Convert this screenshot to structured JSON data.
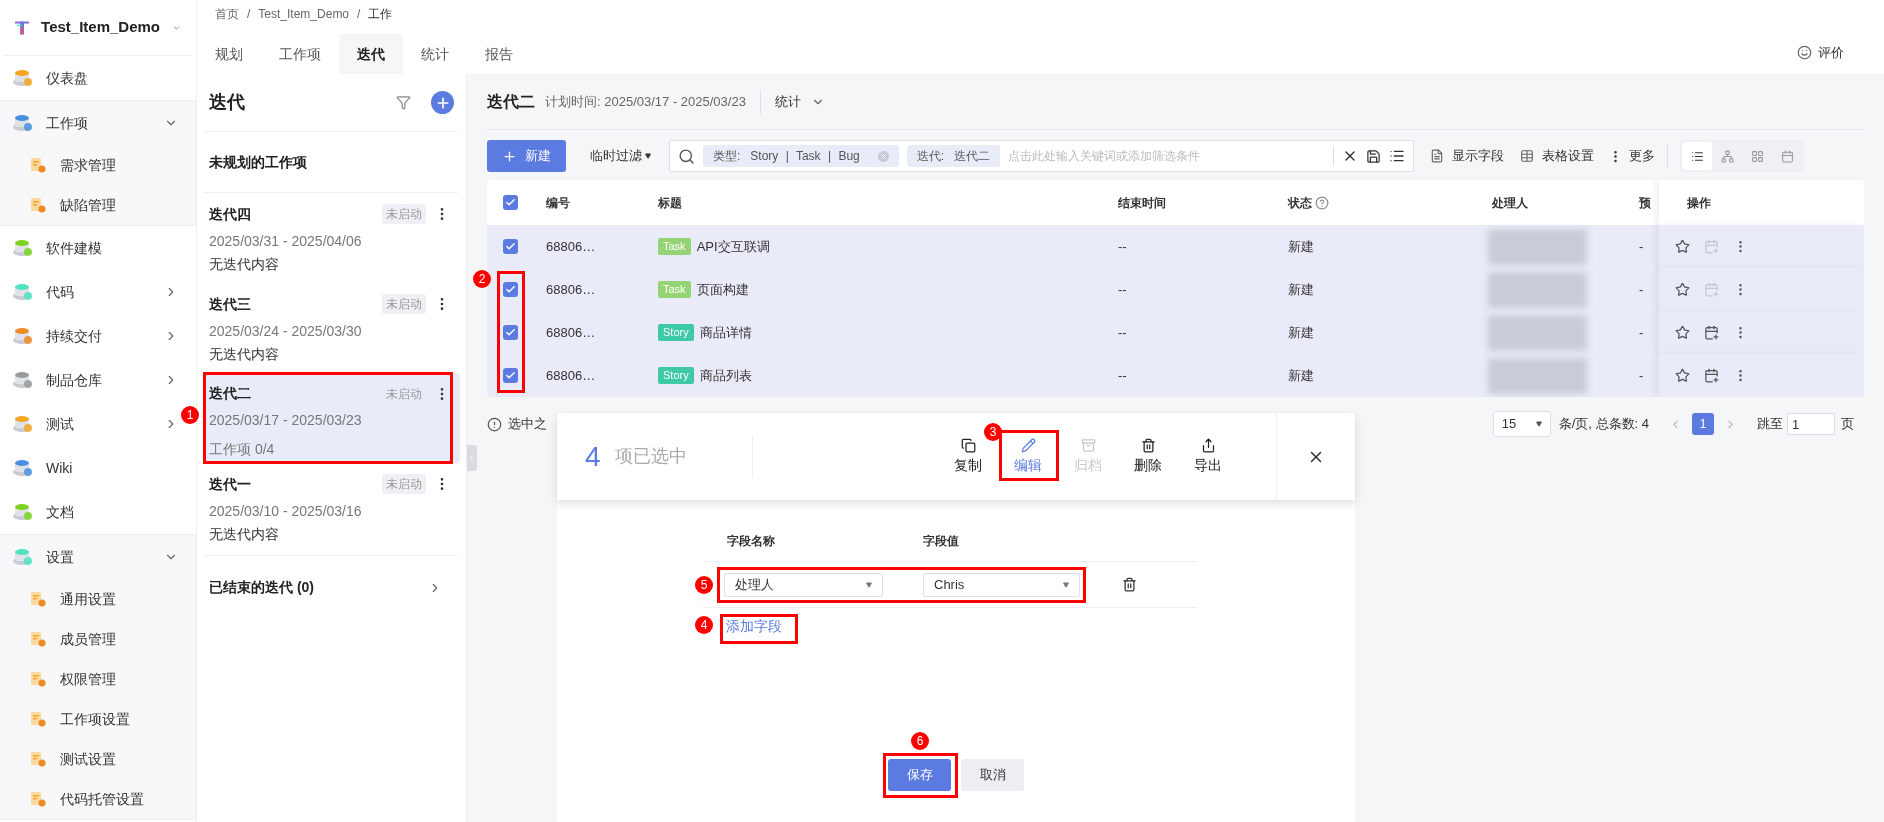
{
  "sidebar": {
    "project": "Test_Item_Demo",
    "items": [
      {
        "label": "仪表盘"
      },
      {
        "label": "工作项",
        "expanded": true,
        "children": [
          {
            "label": "需求管理"
          },
          {
            "label": "缺陷管理"
          }
        ]
      },
      {
        "label": "软件建模"
      },
      {
        "label": "代码",
        "expanded": false
      },
      {
        "label": "持续交付",
        "expanded": false
      },
      {
        "label": "制品仓库",
        "expanded": false
      },
      {
        "label": "测试",
        "expanded": false
      },
      {
        "label": "Wiki"
      },
      {
        "label": "文档"
      },
      {
        "label": "设置",
        "expanded": true,
        "children": [
          {
            "label": "通用设置"
          },
          {
            "label": "成员管理"
          },
          {
            "label": "权限管理"
          },
          {
            "label": "工作项设置"
          },
          {
            "label": "测试设置"
          },
          {
            "label": "代码托管设置"
          }
        ]
      }
    ]
  },
  "breadcrumb": [
    "首页",
    "/",
    "Test_Item_Demo",
    "/",
    "工作"
  ],
  "tabs": [
    {
      "label": "规划",
      "selected": false
    },
    {
      "label": "工作项",
      "selected": false
    },
    {
      "label": "迭代",
      "selected": true
    },
    {
      "label": "统计",
      "selected": false
    },
    {
      "label": "报告",
      "selected": false
    }
  ],
  "feedback": "评价",
  "iteration_panel": {
    "title": "迭代",
    "unplanned": "未规划的工作项",
    "iterations": [
      {
        "name": "迭代四",
        "status": "未启动",
        "dates": "2025/03/31 - 2025/04/06",
        "summary": "无迭代内容",
        "selected": false
      },
      {
        "name": "迭代三",
        "status": "未启动",
        "dates": "2025/03/24 - 2025/03/30",
        "summary": "无迭代内容",
        "selected": false
      },
      {
        "name": "迭代二",
        "status": "未启动",
        "dates": "2025/03/17 - 2025/03/23",
        "summary": "工作项 0/4",
        "selected": true
      },
      {
        "name": "迭代一",
        "status": "未启动",
        "dates": "2025/03/10 - 2025/03/16",
        "summary": "无迭代内容",
        "selected": false
      }
    ],
    "ended": "已结束的迭代 (0)"
  },
  "header": {
    "title": "迭代二",
    "plan": "计划时间: 2025/03/17 - 2025/03/23",
    "stats": "统计"
  },
  "toolbar": {
    "new": "新建",
    "filter": "临时过滤",
    "chips": [
      {
        "key": "类型:",
        "value": "Story | Task | Bug",
        "removable": true
      },
      {
        "key": "迭代:",
        "value": "迭代二",
        "removable": false
      }
    ],
    "placeholder": "点击此处输入关键词或添加筛选条件",
    "fields": "显示字段",
    "table_settings": "表格设置",
    "more": "更多",
    "views": [
      {
        "kind": "list",
        "selected": true
      },
      {
        "kind": "tree",
        "selected": false
      },
      {
        "kind": "grid",
        "selected": false
      },
      {
        "kind": "calendar",
        "selected": false
      }
    ]
  },
  "table": {
    "all_checked": true,
    "columns": [
      "编号",
      "标题",
      "结束时间",
      "状态",
      "处理人",
      "预",
      "操作"
    ],
    "rows": [
      {
        "id": "68806…",
        "tag": {
          "label": "Task",
          "color": "#95d475"
        },
        "title": "API交互联调",
        "end": "--",
        "status": "新建",
        "column_6": "-",
        "checked": true,
        "plan_enabled": false
      },
      {
        "id": "68806…",
        "tag": {
          "label": "Task",
          "color": "#95d475"
        },
        "title": "页面构建",
        "end": "--",
        "status": "新建",
        "column_6": "-",
        "checked": true,
        "plan_enabled": false
      },
      {
        "id": "68806…",
        "tag": {
          "label": "Story",
          "color": "#3ec9a7"
        },
        "title": "商品详情",
        "end": "--",
        "status": "新建",
        "column_6": "-",
        "checked": true,
        "plan_enabled": true
      },
      {
        "id": "68806…",
        "tag": {
          "label": "Story",
          "color": "#3ec9a7"
        },
        "title": "商品列表",
        "end": "--",
        "status": "新建",
        "column_6": "-",
        "checked": true,
        "plan_enabled": true
      }
    ]
  },
  "pagination": {
    "note": "选中之",
    "page_size": "15",
    "per_page": "条/页, 总条数: 4",
    "pages": [
      {
        "label": "1",
        "selected": true
      }
    ],
    "jump": "跳至",
    "jump_value": "1",
    "page_unit": "页"
  },
  "bulk": {
    "count": "4",
    "label": "项已选中",
    "actions": [
      {
        "kind": "copy",
        "label": "复制",
        "selected": false,
        "disabled": false
      },
      {
        "kind": "edit",
        "label": "编辑",
        "selected": true,
        "disabled": false
      },
      {
        "kind": "archive",
        "label": "归档",
        "selected": false,
        "disabled": true
      },
      {
        "kind": "delete",
        "label": "删除",
        "selected": false,
        "disabled": false
      },
      {
        "kind": "export",
        "label": "导出",
        "selected": false,
        "disabled": false
      }
    ]
  },
  "edit_form": {
    "columns": [
      "字段名称",
      "字段值"
    ],
    "fields": [
      {
        "name": "处理人",
        "value": "Chris"
      }
    ],
    "add": "添加字段",
    "save": "保存",
    "cancel": "取消"
  },
  "annotations": [
    {
      "label": "1"
    },
    {
      "label": "2"
    },
    {
      "label": "3"
    },
    {
      "label": "4"
    },
    {
      "label": "5"
    },
    {
      "label": "6"
    }
  ]
}
